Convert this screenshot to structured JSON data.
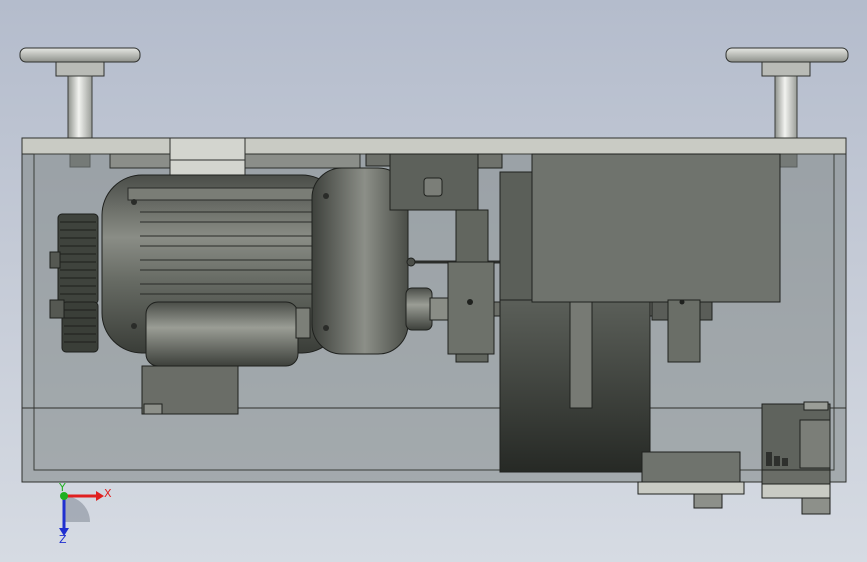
{
  "triad": {
    "x_label": "X",
    "y_label": "Y",
    "z_label": "Z",
    "x_color": "#e02020",
    "y_color": "#20b020",
    "z_color": "#2030d0"
  },
  "colors": {
    "plate": "#c9cbc4",
    "enclosure_fill": "#7e8584",
    "motor_body": "#5a5e58",
    "dark_part": "#3d413b",
    "gearbox_block": "#6f736d"
  }
}
